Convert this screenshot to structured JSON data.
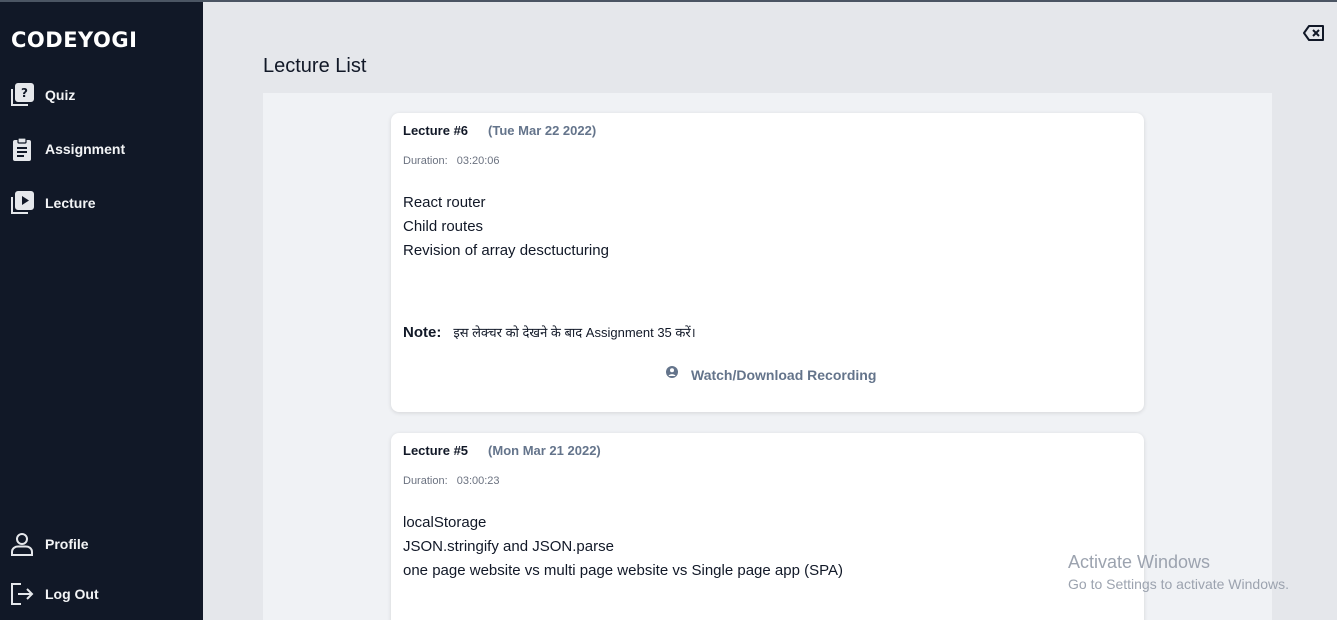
{
  "sidebar": {
    "brand": "CODEYOGI",
    "items": [
      {
        "label": "Quiz",
        "icon": "quiz-icon"
      },
      {
        "label": "Assignment",
        "icon": "clipboard-icon"
      },
      {
        "label": "Lecture",
        "icon": "video-icon"
      }
    ],
    "bottom_items": [
      {
        "label": "Profile",
        "icon": "user-icon"
      },
      {
        "label": "Log Out",
        "icon": "logout-icon"
      }
    ]
  },
  "header": {
    "title": "Lecture List",
    "close_icon": "backspace-icon"
  },
  "lectures": [
    {
      "number": "Lecture #6",
      "date": "(Tue Mar 22 2022)",
      "duration_label": "Duration:",
      "duration": "03:20:06",
      "topics": [
        "React router",
        "Child routes",
        "Revision of array desctucturing"
      ],
      "note_label": "Note:",
      "note": "इस लेक्चर को देखने के बाद Assignment 35 करें।",
      "action": "Watch/Download Recording"
    },
    {
      "number": "Lecture #5",
      "date": "(Mon Mar 21 2022)",
      "duration_label": "Duration:",
      "duration": "03:00:23",
      "topics": [
        "localStorage",
        "JSON.stringify and JSON.parse",
        "one page website vs multi page website vs Single page app (SPA)"
      ]
    }
  ],
  "watermark": {
    "title": "Activate Windows",
    "subtitle": "Go to Settings to activate Windows."
  },
  "colors": {
    "sidebar_bg": "#111827",
    "page_bg": "#e5e7eb",
    "list_bg": "#f0f2f5",
    "muted_text": "#64748b"
  }
}
